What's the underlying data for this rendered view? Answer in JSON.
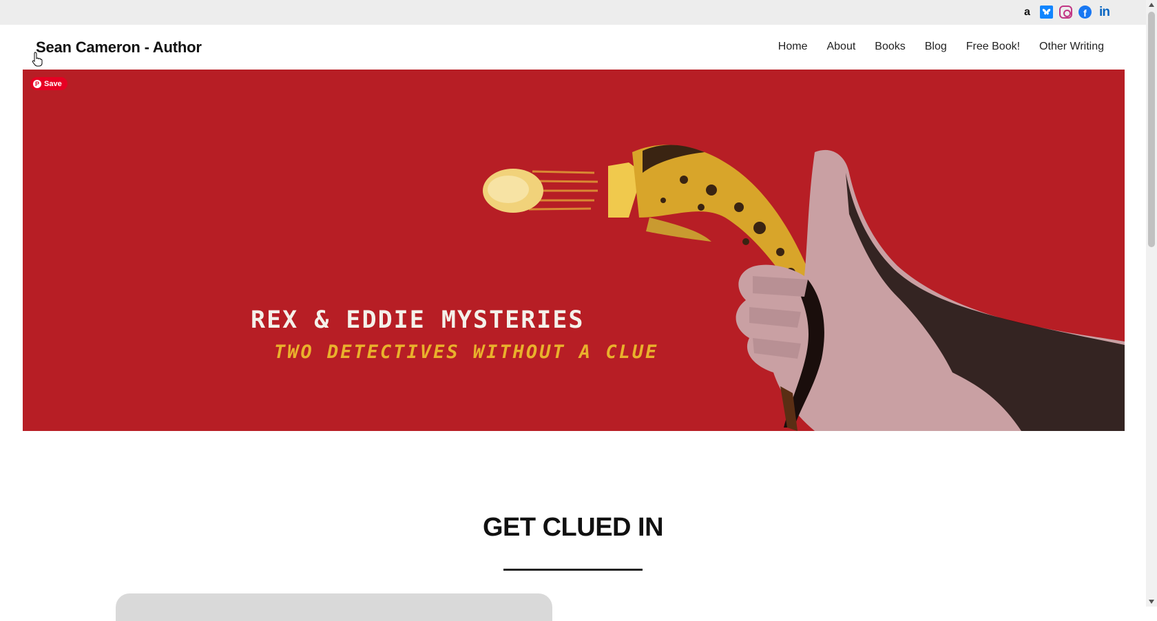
{
  "site": {
    "title": "Sean Cameron - Author"
  },
  "social": [
    {
      "name": "amazon",
      "glyph": "a"
    },
    {
      "name": "bluesky",
      "glyph": ""
    },
    {
      "name": "instagram",
      "glyph": ""
    },
    {
      "name": "facebook",
      "glyph": "f"
    },
    {
      "name": "linkedin",
      "glyph": "in"
    }
  ],
  "nav": {
    "home": "Home",
    "about": "About",
    "books": "Books",
    "blog": "Blog",
    "free_book": "Free Book!",
    "other_writing": "Other Writing"
  },
  "hero": {
    "save_label": "Save",
    "pin_glyph": "P",
    "title": "REX & EDDIE MYSTERIES",
    "subtitle": "TWO DETECTIVES WITHOUT A CLUE",
    "bg_color": "#b71e25"
  },
  "section": {
    "title": "GET CLUED IN"
  },
  "colors": {
    "accent_red": "#b71e25",
    "pinterest": "#e60023",
    "title_cream": "#f4f1ea",
    "subtitle_gold": "#e9b12c"
  }
}
